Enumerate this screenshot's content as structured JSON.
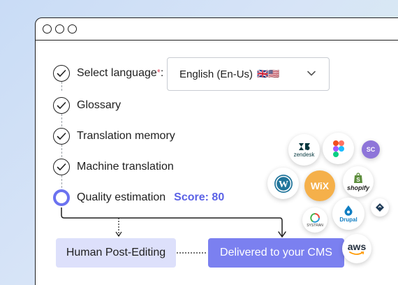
{
  "window": {
    "title_dots": [
      "dot-1",
      "dot-2",
      "dot-3"
    ]
  },
  "steps": {
    "language": {
      "label": "Select language",
      "required_marker": "*",
      "colon": ":",
      "icon": "check-circle-icon"
    },
    "glossary": {
      "label": "Glossary",
      "icon": "check-circle-icon"
    },
    "memory": {
      "label": "Translation memory",
      "icon": "check-circle-icon"
    },
    "machine": {
      "label": "Machine translation",
      "icon": "check-circle-icon"
    },
    "quality": {
      "label": "Quality estimation",
      "score": "Score: 80",
      "icon": "ring-icon"
    }
  },
  "language_select": {
    "value": "English (En-Us)",
    "flags": "🇬🇧🇺🇸",
    "icon": "chevron-down-icon"
  },
  "boxes": {
    "human": "Human Post-Editing",
    "delivered": "Delivered to your CMS"
  },
  "integrations": {
    "zendesk": "zendesk",
    "wix": "WiX",
    "shopify": "shopify",
    "systran": "SYSTRAN",
    "drupal": "Drupal",
    "aws": "aws"
  },
  "colors": {
    "accent": "#6b72f0",
    "score": "#5b62e6",
    "human_box": "#dde0fb",
    "delivered_box": "#7b80f0",
    "required": "#e0445a",
    "wix": "#f5b04a",
    "shopify": "#5e8e3e",
    "drupal": "#0f7dc2",
    "wordpress": "#21759b"
  }
}
